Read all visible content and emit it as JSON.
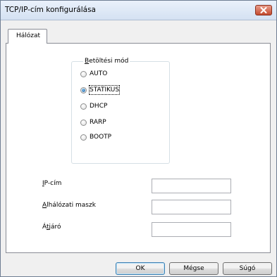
{
  "window": {
    "title": "TCP/IP-cím konfigurálása",
    "close_icon": "close-icon"
  },
  "tabs": [
    {
      "label": "Hálózat",
      "active": true
    }
  ],
  "boot_mode": {
    "legend_mnemonic": "B",
    "legend_rest": "etöltési mód",
    "selected": "STATIKUS",
    "options": [
      "AUTO",
      "STATIKUS",
      "DHCP",
      "RARP",
      "BOOTP"
    ]
  },
  "fields": [
    {
      "mnemonic": "I",
      "prefix": "",
      "rest": "P-cím",
      "value": ""
    },
    {
      "mnemonic": "A",
      "prefix": "",
      "rest": "lhálózati maszk",
      "value": ""
    },
    {
      "mnemonic": "t",
      "prefix": "Á",
      "rest": "járó",
      "value": ""
    }
  ],
  "buttons": {
    "ok": "OK",
    "cancel": "Mégse",
    "help": "Súgó"
  },
  "colors": {
    "accent": "#3c7fb1",
    "close": "#c44a2e"
  }
}
